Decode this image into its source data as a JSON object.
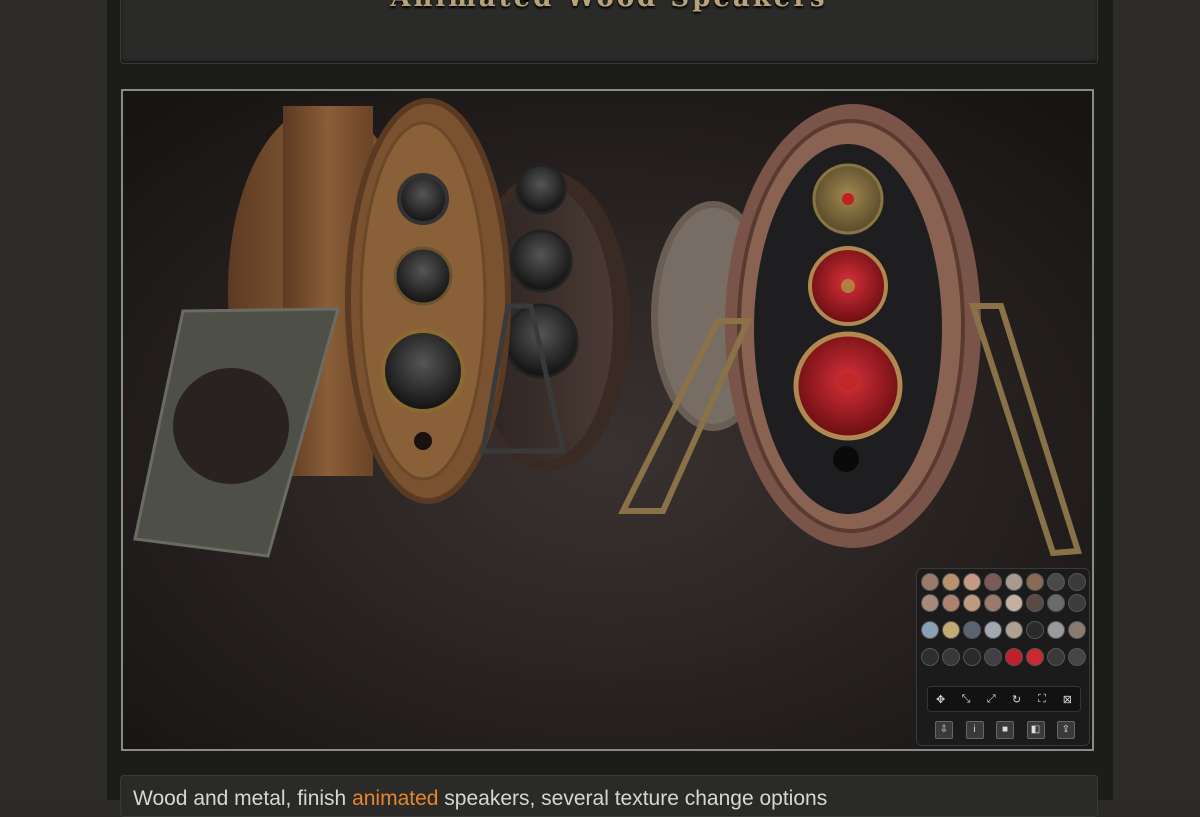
{
  "header": {
    "title": "Animated Wood Speakers"
  },
  "caption": {
    "before": "Wood and metal, finish ",
    "highlight": "animated",
    "after": " speakers, several texture change options"
  },
  "colors": {
    "accent": "#e8852d",
    "frame": "#8a8a86",
    "background": "#1c1c1b"
  },
  "palette": {
    "rows": [
      [
        "#9a7a68",
        "#b9916c",
        "#c49a86",
        "#7b5a57",
        "#a89a8f",
        "#8b6a55",
        "#4a4a4a",
        "#3a3a3a"
      ],
      [
        "#a88a7a",
        "#b08070",
        "#c09a80",
        "#9a7a6a",
        "#c4b0a0",
        "#5a4a44",
        "#6a6a6a",
        "#3c3c3c"
      ],
      [
        "#8aa0b4",
        "#c4aa70",
        "#5a6470",
        "#a0a8b0",
        "#b0a090",
        "#2a2a2a",
        "#9a9a9a",
        "#8a7a70"
      ],
      [
        "#2e2e30",
        "#38383a",
        "#2a2a2c",
        "#404044",
        "#c0202a",
        "#c82a30",
        "#3a3a3a",
        "#454545"
      ]
    ],
    "controls": [
      "move-icon",
      "shrink-icon",
      "expand-icon",
      "reset-icon",
      "fullscreen-icon",
      "collapse-icon"
    ],
    "tools": [
      "download-icon",
      "info-icon",
      "color-icon",
      "cube-icon",
      "export-icon"
    ]
  }
}
